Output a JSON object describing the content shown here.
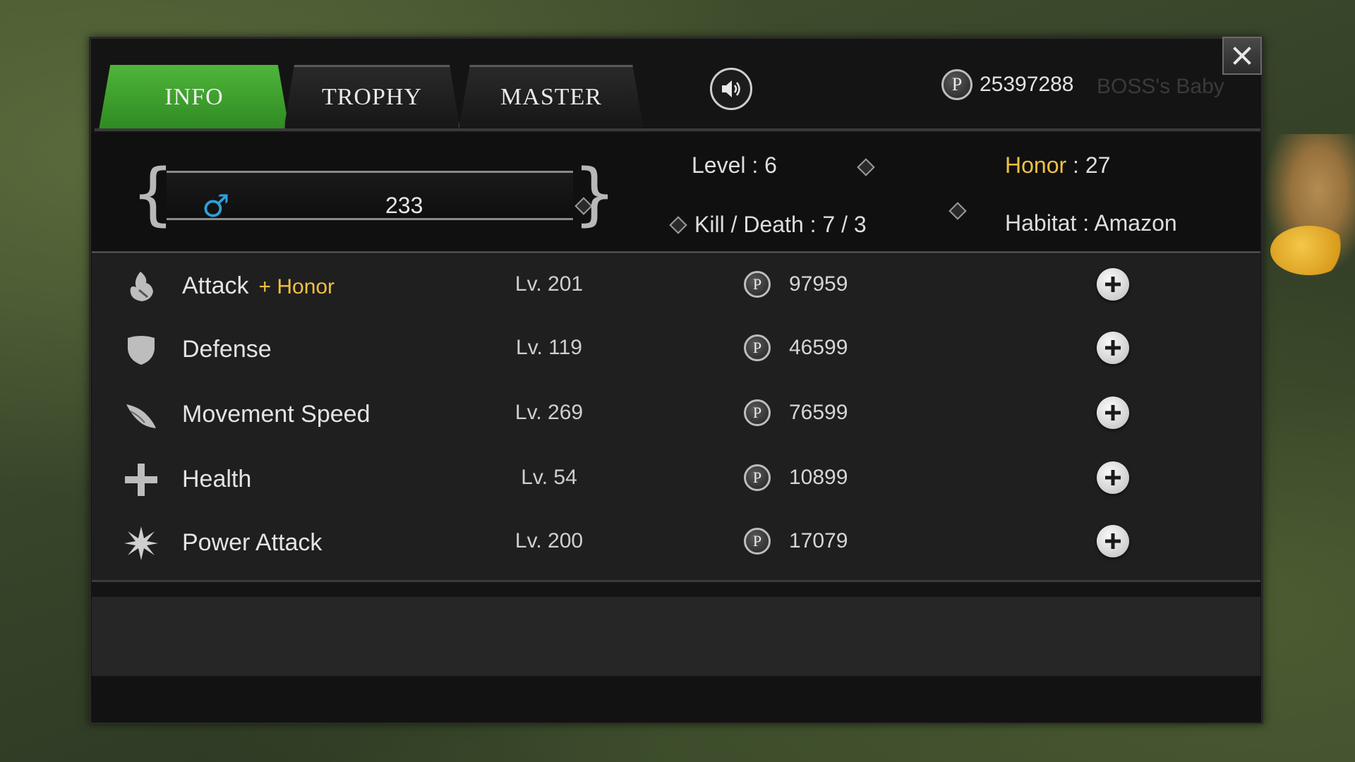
{
  "tabs": [
    {
      "label": "INFO",
      "active": true
    },
    {
      "label": "TROPHY",
      "active": false
    },
    {
      "label": "MASTER",
      "active": false
    }
  ],
  "currency": {
    "icon_letter": "P",
    "value": "25397288"
  },
  "player_name": "BOSS's Baby",
  "profile": {
    "gender_symbol": "♂",
    "name_value": "233",
    "level_label": "Level : ",
    "level_value": "6",
    "honor_label": "Honor",
    "honor_value": " : 27",
    "kd_label": "Kill / Death : ",
    "kd_value": "7 / 3",
    "habitat_label": "Habitat : ",
    "habitat_value": "Amazon"
  },
  "upgrades": [
    {
      "name": "Attack",
      "bonus": "+ Honor",
      "level": "Lv. 201",
      "cost": "97959",
      "icon": "flame-claw-icon"
    },
    {
      "name": "Defense",
      "bonus": "",
      "level": "Lv. 119",
      "cost": "46599",
      "icon": "shield-icon"
    },
    {
      "name": "Movement Speed",
      "bonus": "",
      "level": "Lv. 269",
      "cost": "76599",
      "icon": "wing-icon"
    },
    {
      "name": "Health",
      "bonus": "",
      "level": "Lv. 54",
      "cost": "10899",
      "icon": "cross-icon"
    },
    {
      "name": "Power Attack",
      "bonus": "",
      "level": "Lv. 200",
      "cost": "17079",
      "icon": "burst-icon"
    }
  ],
  "colors": {
    "active_tab": "#3fa52e",
    "gold": "#f0c040",
    "gender": "#2f9fd6"
  }
}
